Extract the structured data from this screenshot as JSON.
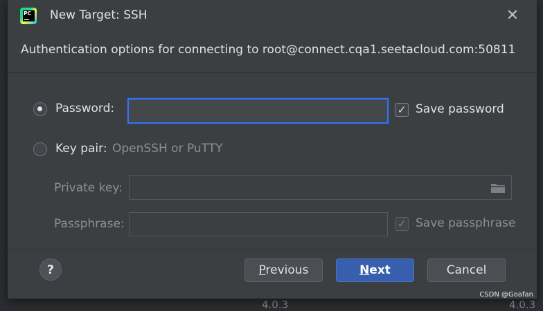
{
  "background": {
    "fragments": [
      "4.0.3",
      "4.0.3"
    ]
  },
  "dialog": {
    "title": "New Target: SSH",
    "app_icon_text": "PC",
    "close_icon": "close-icon",
    "subtitle": "Authentication options for connecting to root@connect.cqa1.seetacloud.com:50811"
  },
  "auth": {
    "password": {
      "label": "Password:",
      "value": "",
      "selected": true,
      "save_label": "Save password",
      "save_checked": true
    },
    "key_pair": {
      "label": "Key pair:",
      "hint": "OpenSSH or PuTTY",
      "selected": false,
      "private_key_label": "Private key:",
      "private_key_value": "",
      "browse_icon": "folder-icon",
      "passphrase_label": "Passphrase:",
      "passphrase_value": "",
      "save_passphrase_label": "Save passphrase",
      "save_passphrase_checked": true
    }
  },
  "footer": {
    "help_label": "?",
    "previous_label_mnemonic": "P",
    "previous_label_rest": "revious",
    "next_label_mnemonic": "N",
    "next_label_rest": "ext",
    "cancel_label": "Cancel"
  },
  "watermark": "CSDN @Goafan",
  "colors": {
    "accent": "#3574f0",
    "primary_button": "#375fad",
    "dialog_bg": "#3c3f41",
    "text": "#dfe1e5",
    "dim_text": "#8b8e94"
  }
}
